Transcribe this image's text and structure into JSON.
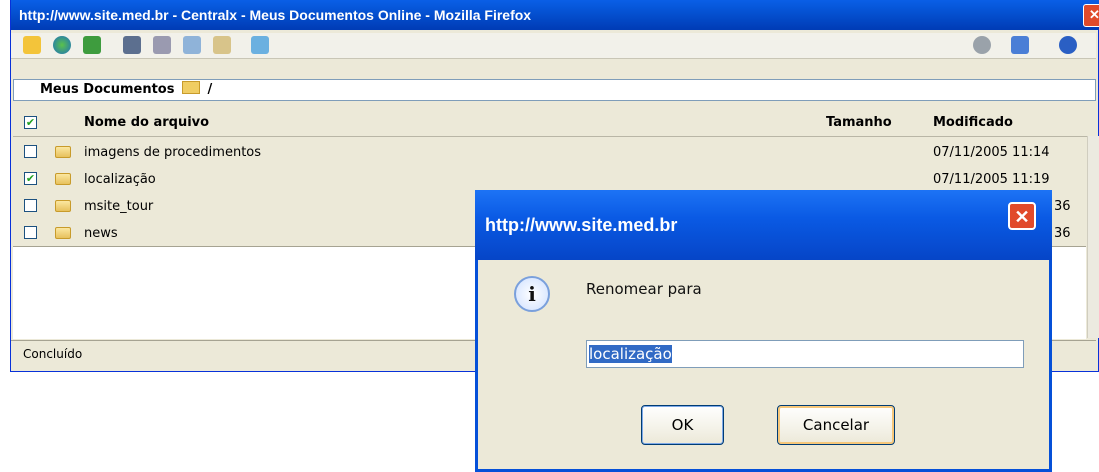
{
  "window": {
    "title": "http://www.site.med.br - Centralx - Meus Documentos Online - Mozilla Firefox",
    "close_glyph": "✕"
  },
  "toolbar": {
    "left_icons": [
      "new-folder-icon",
      "globe-icon",
      "refresh-icon",
      "properties-icon",
      "cut-icon",
      "copy-icon",
      "paste-icon",
      "upload-icon"
    ],
    "right_icons": [
      "drive-icon",
      "view-grid-icon",
      "help-icon"
    ]
  },
  "path": {
    "root": "Meus Documentos",
    "separator": "/"
  },
  "columns": {
    "name": "Nome do arquivo",
    "size": "Tamanho",
    "modified": "Modificado"
  },
  "files": [
    {
      "name": "imagens de procedimentos",
      "date": "07/11/2005 11:14",
      "checked": false
    },
    {
      "name": "localização",
      "date": "07/11/2005 11:19",
      "checked": true
    },
    {
      "name": "msite_tour",
      "date": "36",
      "checked": false
    },
    {
      "name": "news",
      "date": "36",
      "checked": false
    }
  ],
  "status": "Concluído",
  "dialog": {
    "title": "http://www.site.med.br",
    "message": "Renomear para",
    "input_value": "localização",
    "ok_label": "OK",
    "cancel_label": "Cancelar",
    "icon": "info-icon"
  },
  "colors": {
    "titlebar": "#0450d0",
    "close": "#e04a2a",
    "selection": "#316ac5"
  }
}
